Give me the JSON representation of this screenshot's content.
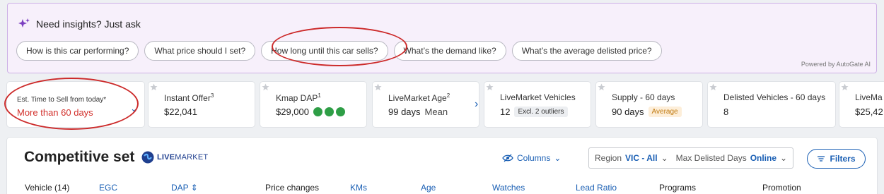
{
  "insights": {
    "title": "Need insights? Just ask",
    "chips": [
      "How is this car performing?",
      "What price should I set?",
      "How long until this car sells?",
      "What’s the demand like?",
      "What’s the average delisted price?"
    ],
    "powered_by": "Powered by AutoGate AI",
    "accent_color": "#7b3fc0"
  },
  "cards": [
    {
      "label": "Est. Time to Sell from today*",
      "value": "More than 60 days"
    },
    {
      "label": "Instant Offer",
      "label_sup": "3",
      "value": "$22,041"
    },
    {
      "label": "Kmap DAP",
      "label_sup": "1",
      "value": "$29,000",
      "rating_dots": 3
    },
    {
      "label": "LiveMarket Age",
      "label_sup": "2",
      "value": "99 days",
      "value_suffix": "Mean"
    },
    {
      "label": "LiveMarket Vehicles",
      "value": "12",
      "tag": "Excl. 2 outliers"
    },
    {
      "label": "Supply - 60 days",
      "value": "90 days",
      "tag": "Average"
    },
    {
      "label": "Delisted Vehicles - 60 days",
      "value": "8"
    },
    {
      "label": "LiveMa",
      "value": "$25,42"
    }
  ],
  "competitive": {
    "title": "Competitive set",
    "logo_bold": "LIVE",
    "logo_rest": "MARKET",
    "columns_label": "Columns",
    "region_label": "Region",
    "region_value": "VIC - All",
    "delisted_label": "Max Delisted Days",
    "delisted_value": "Online",
    "filters_label": "Filters",
    "headers": [
      "Vehicle (14)",
      "EGC",
      "DAP ⇕",
      "Price changes",
      "KMs",
      "Age",
      "Watches",
      "Lead Ratio",
      "Programs",
      "Promotion"
    ]
  },
  "colors": {
    "link": "#1a5fb4",
    "alert_red": "#d2302b",
    "good_green": "#2e9e46"
  }
}
